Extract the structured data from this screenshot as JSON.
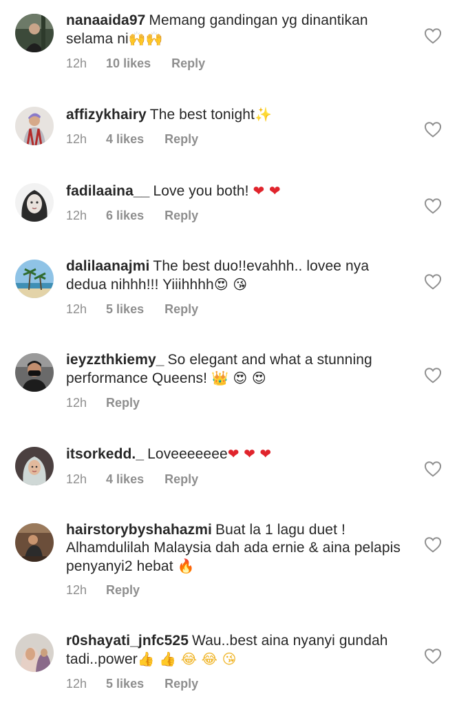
{
  "comments": [
    {
      "username": "nanaaida97",
      "text": "Memang gandingan yg dinantikan selama ni",
      "emoji": "🙌🙌",
      "time": "12h",
      "likes": "10 likes",
      "reply": "Reply"
    },
    {
      "username": "affizykhairy",
      "text": "The best tonight",
      "emoji": "✨",
      "time": "12h",
      "likes": "4 likes",
      "reply": "Reply"
    },
    {
      "username": "fadilaaina__",
      "text": "Love you both!",
      "emoji": "❤ ❤",
      "time": "12h",
      "likes": "6 likes",
      "reply": "Reply"
    },
    {
      "username": "dalilaanajmi",
      "text": "The best duo!!evahhh.. lovee nya dedua nihhh!!! Yiiihhhh",
      "emoji": "😍 😘",
      "time": "12h",
      "likes": "5 likes",
      "reply": "Reply"
    },
    {
      "username": "ieyzzthkiemy_",
      "text": "So elegant and what a stunning performance Queens!",
      "emoji": "👑 😍 😍",
      "time": "12h",
      "likes": "",
      "reply": "Reply"
    },
    {
      "username": "itsorkedd._",
      "text": "Loveeeeeee",
      "emoji": "❤ ❤ ❤",
      "time": "12h",
      "likes": "4 likes",
      "reply": "Reply"
    },
    {
      "username": "hairstorybyshahazmi",
      "text": "Buat la 1 lagu duet ! Alhamdulilah Malaysia dah ada ernie & aina pelapis penyanyi2 hebat",
      "emoji": "🔥",
      "time": "12h",
      "likes": "",
      "reply": "Reply"
    },
    {
      "username": "r0shayati_jnfc525",
      "text": "Wau..best aina nyanyi gundah tadi..power",
      "emoji": "👍 👍 😂 😂 😘",
      "time": "12h",
      "likes": "5 likes",
      "reply": "Reply"
    }
  ],
  "colors": {
    "text": "#262626",
    "meta": "#8e8e8e",
    "heart_outline": "#8e8e8e",
    "red_heart": "#e0242c"
  }
}
